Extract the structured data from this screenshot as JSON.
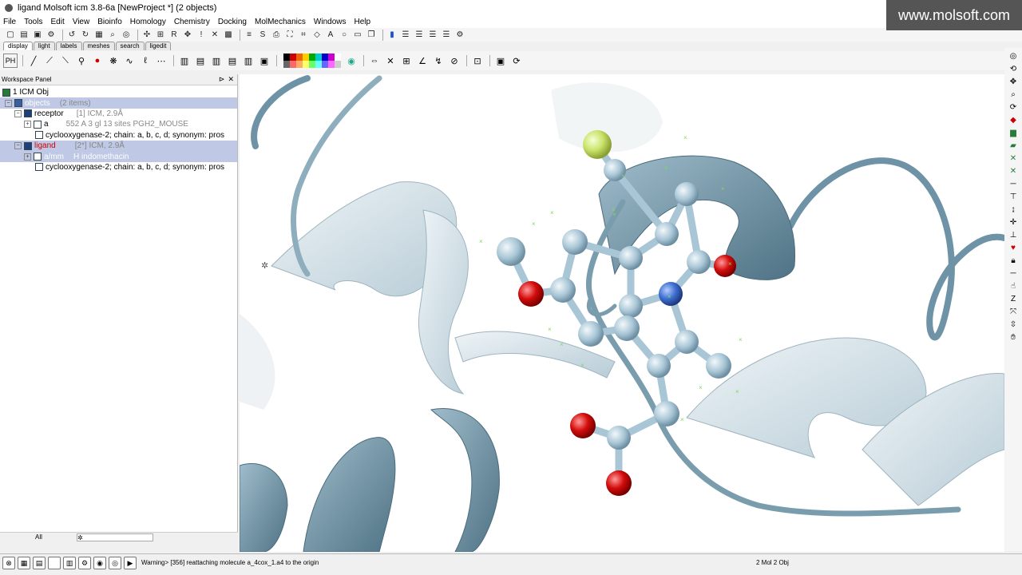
{
  "window": {
    "title": "ligand Molsoft icm 3.8-6a  [NewProject *] (2 objects)"
  },
  "watermark": "www.molsoft.com",
  "menu": [
    "File",
    "Tools",
    "Edit",
    "View",
    "Bioinfo",
    "Homology",
    "Chemistry",
    "Docking",
    "MolMechanics",
    "Windows",
    "Help"
  ],
  "tabs": [
    "display",
    "light",
    "labels",
    "meshes",
    "search",
    "ligedit"
  ],
  "workspace": {
    "header": "Workspace Panel",
    "root": "1 ICM Obj",
    "objects_label": "objects",
    "objects_count": "(2 items)",
    "receptor": {
      "name": "receptor",
      "info": "[1] ICM, 2.9Å",
      "chain_name": "a",
      "chain_info": "552 A 3 gl  13 sites PGH2_MOUSE",
      "desc": "cyclooxygenase-2; chain: a, b, c, d; synonym: pros"
    },
    "ligand": {
      "name": "ligand",
      "info": "[2*] ICM, 2.9Å",
      "chain_name": "a/mm",
      "chain_info": "H  indomethacin",
      "desc": "cyclooxygenase-2; chain: a, b, c, d; synonym: pros"
    },
    "footer_label": "All"
  },
  "status": {
    "message": "Warning> [356] reattaching molecule a_4cox_1.a4 to the origin",
    "mol_count": "2 Mol 2 Obj"
  },
  "colors": {
    "ribbon_dark": "#6e93a6",
    "ribbon_light": "#c9dbe3",
    "atom_carbon": "#a9c6d6",
    "atom_oxygen": "#d40b0b",
    "atom_nitrogen": "#3f6fd1",
    "atom_chlorine": "#c9e36a"
  }
}
